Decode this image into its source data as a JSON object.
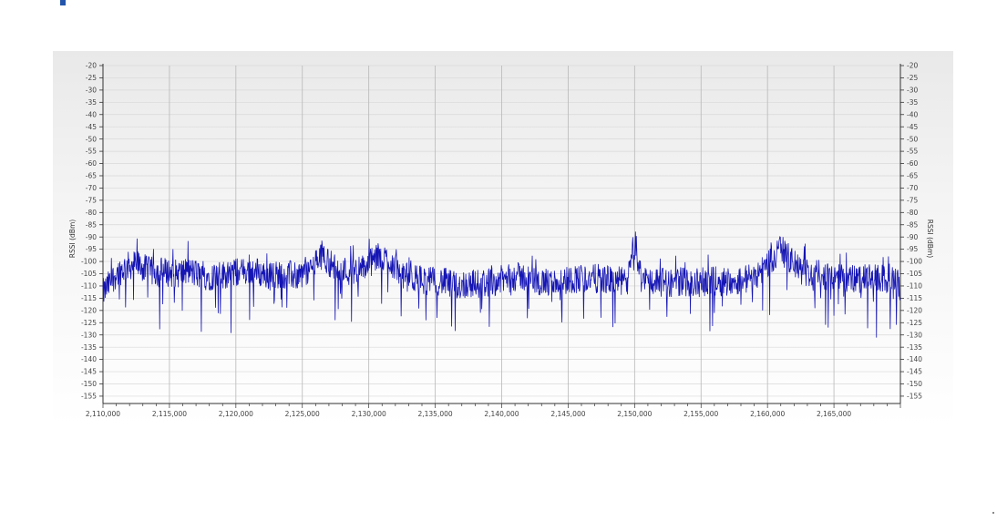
{
  "header": {
    "caption": ""
  },
  "chart_data": {
    "type": "line",
    "title": "",
    "xlabel": "",
    "ylabel": "RSSI (dBm)",
    "ylabel_right": "RSSI (dBm)",
    "xlim": [
      2110000,
      2170000
    ],
    "ylim": [
      -158,
      -20
    ],
    "x_ticks": [
      2110000,
      2115000,
      2120000,
      2125000,
      2130000,
      2135000,
      2140000,
      2145000,
      2150000,
      2155000,
      2160000,
      2165000
    ],
    "x_tick_labels": [
      "2,110,000",
      "2,115,000",
      "2,120,000",
      "2,125,000",
      "2,130,000",
      "2,135,000",
      "2,140,000",
      "2,145,000",
      "2,150,000",
      "2,155,000",
      "2,160,000",
      "2,165,000"
    ],
    "y_ticks": [
      -20,
      -25,
      -30,
      -35,
      -40,
      -45,
      -50,
      -55,
      -60,
      -65,
      -70,
      -75,
      -80,
      -85,
      -90,
      -95,
      -100,
      -105,
      -110,
      -115,
      -120,
      -125,
      -130,
      -135,
      -140,
      -145,
      -150,
      -155
    ],
    "y_tick_labels": [
      "-20",
      "-25",
      "-30",
      "-35",
      "-40",
      "-45",
      "-50",
      "-55",
      "-60",
      "-65",
      "-70",
      "-75",
      "-80",
      "-85",
      "-90",
      "-95",
      "-100",
      "-105",
      "-110",
      "-115",
      "-120",
      "-125",
      "-130",
      "-135",
      "-140",
      "-145",
      "-150",
      "-155"
    ],
    "grid": true,
    "colors": {
      "series": "#1515b4",
      "grid_major": "#b8b8b8",
      "grid_minor": "#d8d8d8",
      "axis": "#333333"
    },
    "series": [
      {
        "x": [
          2110000,
          2111000,
          2111800,
          2112500,
          2113500,
          2114500,
          2115500,
          2116500,
          2117500,
          2118500,
          2119500,
          2120500,
          2121500,
          2122500,
          2123500,
          2124500,
          2125500,
          2126500,
          2127500,
          2128500,
          2129500,
          2130500,
          2131500,
          2132500,
          2133500,
          2134500,
          2135500,
          2136500,
          2137500,
          2138500,
          2139500,
          2140500,
          2141500,
          2142500,
          2143500,
          2144500,
          2145500,
          2146500,
          2147500,
          2148500,
          2149500,
          2150000,
          2150500,
          2151500,
          2152500,
          2153500,
          2154500,
          2155500,
          2156500,
          2157500,
          2158500,
          2159500,
          2160500,
          2161000,
          2161500,
          2162500,
          2163500,
          2164500,
          2165500,
          2166500,
          2167500,
          2168500,
          2169500,
          2170000
        ],
        "y": [
          -113,
          -105,
          -102,
          -101,
          -104,
          -104,
          -105,
          -104,
          -106,
          -106,
          -105,
          -104,
          -104,
          -106,
          -105,
          -106,
          -104,
          -97,
          -103,
          -104,
          -103,
          -99,
          -99,
          -106,
          -107,
          -108,
          -108,
          -110,
          -109,
          -109,
          -108,
          -107,
          -106,
          -108,
          -109,
          -108,
          -107,
          -107,
          -107,
          -108,
          -108,
          -91,
          -107,
          -108,
          -109,
          -108,
          -109,
          -108,
          -108,
          -108,
          -107,
          -104,
          -98,
          -95,
          -98,
          -104,
          -105,
          -106,
          -107,
          -107,
          -107,
          -107,
          -108,
          -110
        ],
        "noise_db": 6,
        "dip_min": -132
      }
    ]
  }
}
